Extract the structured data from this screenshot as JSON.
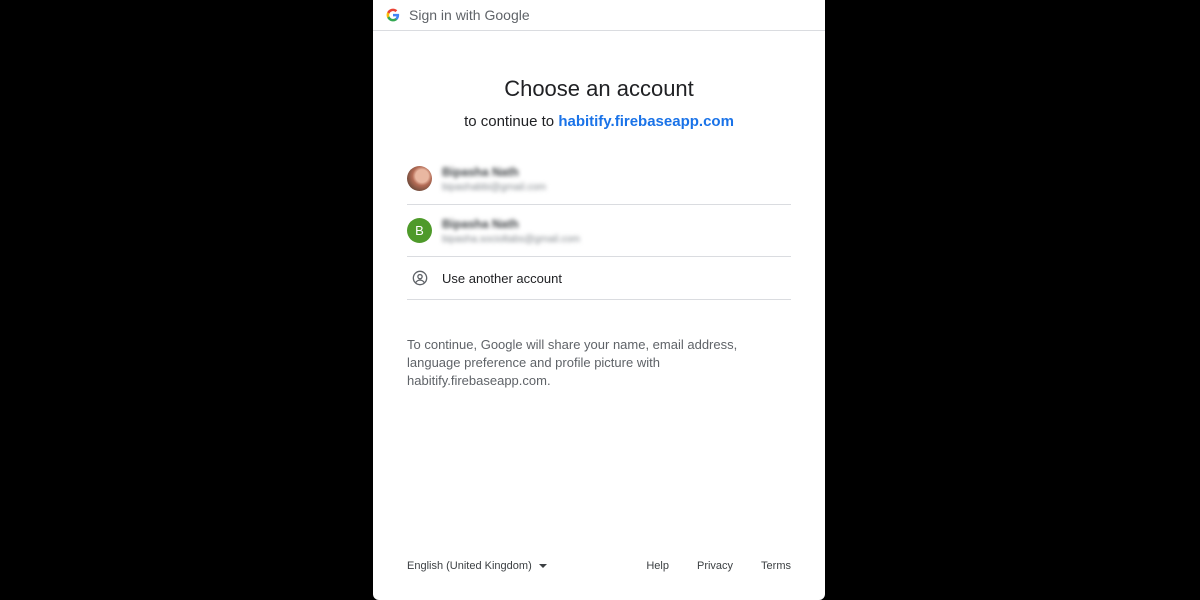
{
  "header": {
    "title": "Sign in with Google"
  },
  "heading": "Choose an account",
  "subheading": {
    "prefix": "to continue to",
    "app": "habitify.firebaseapp.com"
  },
  "accounts": [
    {
      "name": "Bipasha Nath",
      "email": "bipashabbi@gmail.com",
      "avatar": "photo"
    },
    {
      "name": "Bipasha Nath",
      "email": "bipasha.socioltabs@gmail.com",
      "avatar": "letter",
      "letter": "B",
      "avatar_color": "#4e9a2a"
    }
  ],
  "use_another": "Use another account",
  "info": "To continue, Google will share your name, email address, language preference and profile picture with habitify.firebaseapp.com.",
  "footer": {
    "language": "English (United Kingdom)",
    "links": [
      "Help",
      "Privacy",
      "Terms"
    ]
  },
  "colors": {
    "link": "#1a73e8",
    "background": "#000000",
    "dialog": "#ffffff",
    "divider": "#dadce0"
  },
  "icons": {
    "logo": "google-g-icon",
    "account": "account-circle-icon",
    "dropdown": "caret-down-icon"
  }
}
